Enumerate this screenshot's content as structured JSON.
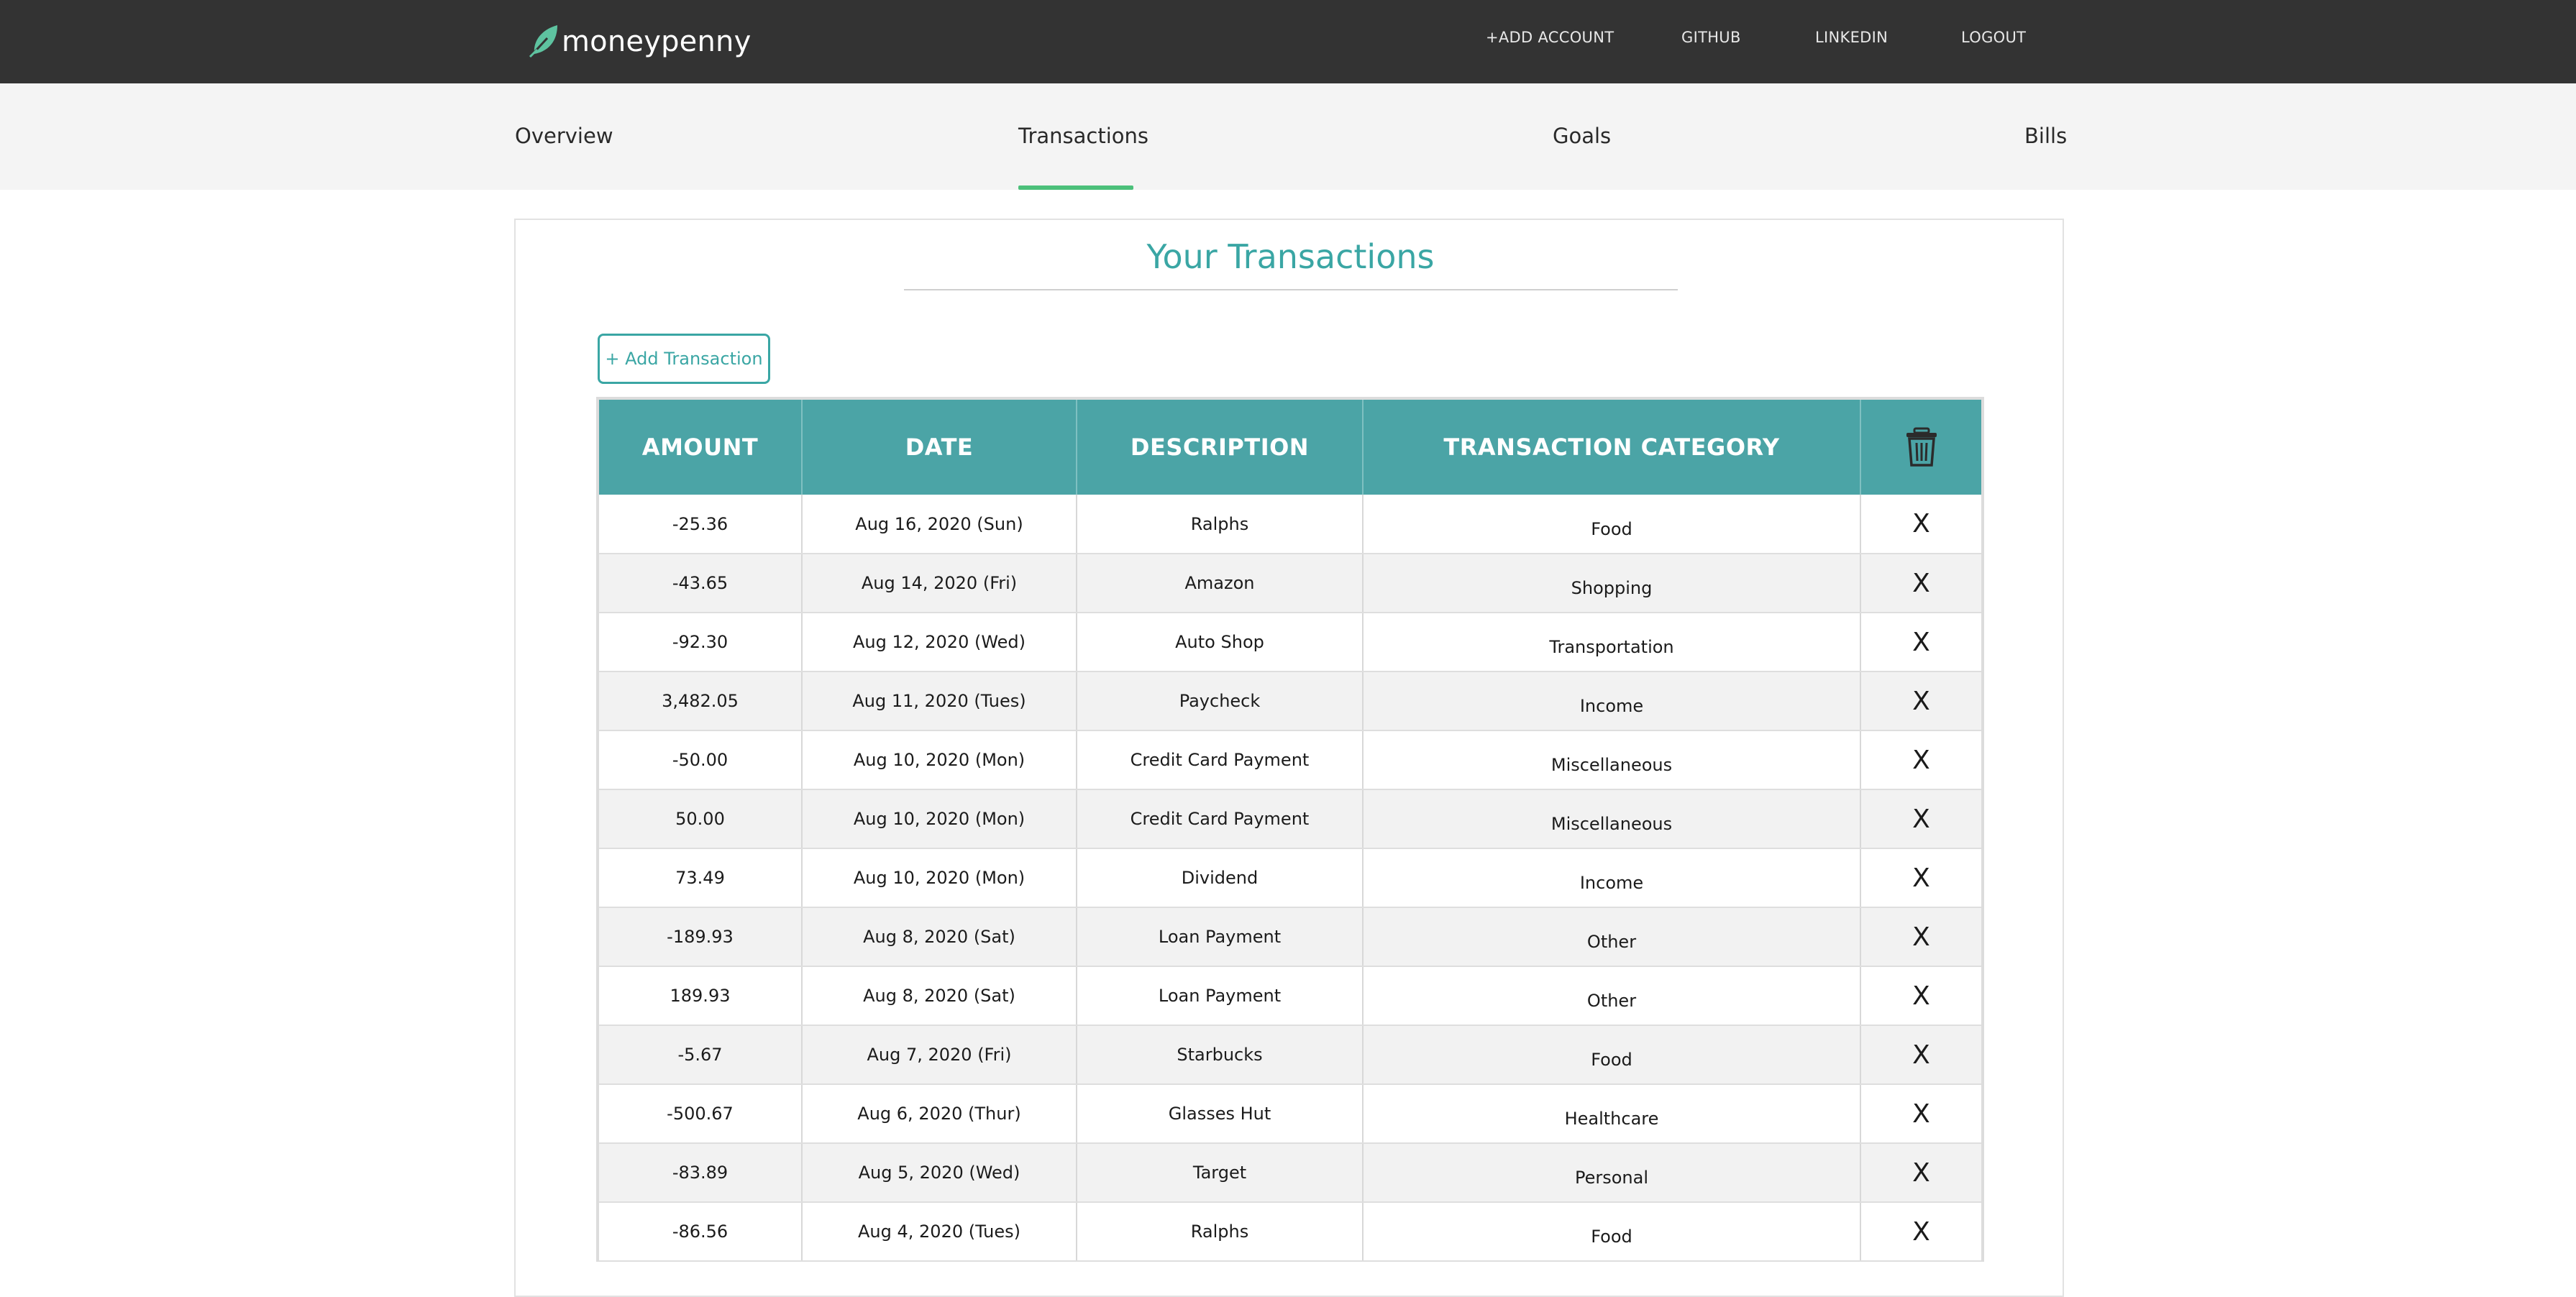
{
  "brand": {
    "name": "moneypenny",
    "accent": "#5ec3a0"
  },
  "nav": {
    "add_account": "+ADD ACCOUNT",
    "github": "GITHUB",
    "linkedin": "LINKEDIN",
    "logout": "LOGOUT"
  },
  "tabs": {
    "overview": "Overview",
    "transactions": "Transactions",
    "goals": "Goals",
    "bills": "Bills",
    "active": "Transactions"
  },
  "page": {
    "title": "Your Transactions",
    "add_button": "+ Add Transaction"
  },
  "table": {
    "headers": {
      "amount": "AMOUNT",
      "date": "DATE",
      "description": "DESCRIPTION",
      "category": "TRANSACTION CATEGORY",
      "delete_icon": "trash-icon"
    },
    "delete_label": "X",
    "rows": [
      {
        "amount": "-25.36",
        "date": "Aug 16, 2020 (Sun)",
        "description": "Ralphs",
        "category": "Food"
      },
      {
        "amount": "-43.65",
        "date": "Aug 14, 2020 (Fri)",
        "description": "Amazon",
        "category": "Shopping"
      },
      {
        "amount": "-92.30",
        "date": "Aug 12, 2020 (Wed)",
        "description": "Auto Shop",
        "category": "Transportation"
      },
      {
        "amount": "3,482.05",
        "date": "Aug 11, 2020 (Tues)",
        "description": "Paycheck",
        "category": "Income"
      },
      {
        "amount": "-50.00",
        "date": "Aug 10, 2020 (Mon)",
        "description": "Credit Card Payment",
        "category": "Miscellaneous"
      },
      {
        "amount": "50.00",
        "date": "Aug 10, 2020 (Mon)",
        "description": "Credit Card Payment",
        "category": "Miscellaneous"
      },
      {
        "amount": "73.49",
        "date": "Aug 10, 2020 (Mon)",
        "description": "Dividend",
        "category": "Income"
      },
      {
        "amount": "-189.93",
        "date": "Aug 8, 2020 (Sat)",
        "description": "Loan Payment",
        "category": "Other"
      },
      {
        "amount": "189.93",
        "date": "Aug 8, 2020 (Sat)",
        "description": "Loan Payment",
        "category": "Other"
      },
      {
        "amount": "-5.67",
        "date": "Aug 7, 2020 (Fri)",
        "description": "Starbucks",
        "category": "Food"
      },
      {
        "amount": "-500.67",
        "date": "Aug 6, 2020 (Thur)",
        "description": "Glasses Hut",
        "category": "Healthcare"
      },
      {
        "amount": "-83.89",
        "date": "Aug 5, 2020 (Wed)",
        "description": "Target",
        "category": "Personal"
      },
      {
        "amount": "-86.56",
        "date": "Aug 4, 2020 (Tues)",
        "description": "Ralphs",
        "category": "Food"
      }
    ]
  },
  "colors": {
    "navbar": "#333333",
    "tabbar": "#f4f4f4",
    "teal": "#4ba4a6",
    "title_teal": "#3aa6a4",
    "active_tab_underline": "#4cc07a"
  }
}
